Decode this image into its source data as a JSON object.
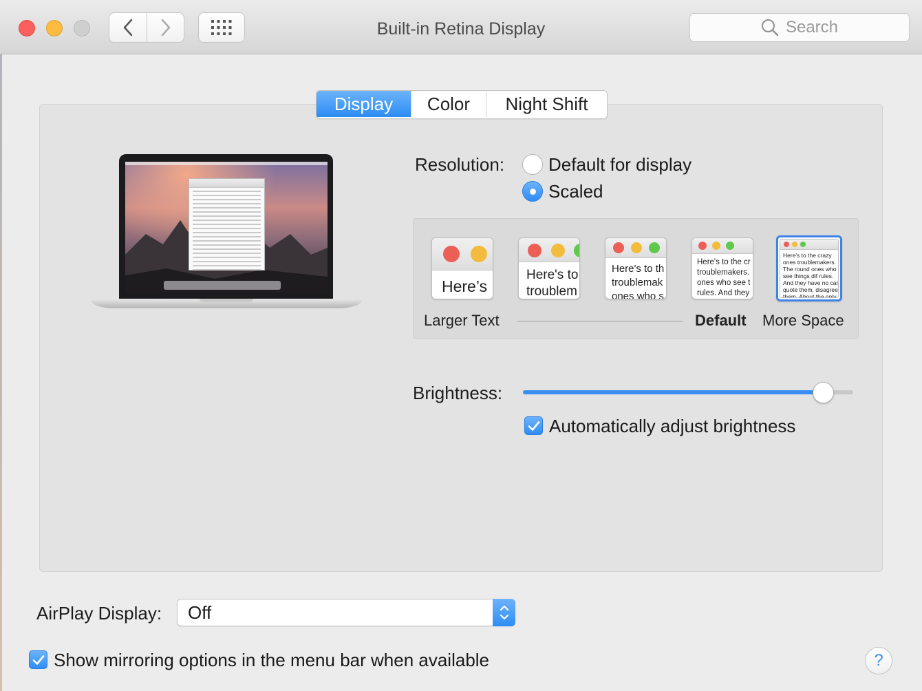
{
  "window": {
    "title": "Built-in Retina Display",
    "search_placeholder": "Search"
  },
  "tabs": [
    {
      "label": "Display",
      "selected": true
    },
    {
      "label": "Color",
      "selected": false
    },
    {
      "label": "Night Shift",
      "selected": false
    }
  ],
  "resolution": {
    "label": "Resolution:",
    "options": [
      {
        "label": "Default for display",
        "checked": false
      },
      {
        "label": "Scaled",
        "checked": true
      }
    ],
    "scaled_previews": [
      {
        "text": "Here’s"
      },
      {
        "text": "Here's to troublem"
      },
      {
        "text": "Here's to th troublemak ones who s"
      },
      {
        "text": "Here's to the cr troublemakers. ones who see t rules. And they"
      },
      {
        "text": "Here's to the crazy ones troublemakers. The round ones who see things dif rules. And they have no can quote them, disagree them. About the only th Because they change t"
      }
    ],
    "scale_labels": {
      "left": "Larger Text",
      "default": "Default",
      "right": "More Space"
    },
    "selected_index": 4
  },
  "brightness": {
    "label": "Brightness:",
    "level_percent": 91,
    "auto_label": "Automatically adjust brightness",
    "auto_checked": true
  },
  "airplay": {
    "label": "AirPlay Display:",
    "value": "Off"
  },
  "mirroring": {
    "label": "Show mirroring options in the menu bar when available",
    "checked": true
  },
  "help": {
    "label": "?"
  },
  "colors": {
    "accent": "#2f8df4",
    "close": "#fc605c",
    "minimize": "#fdbc40",
    "zoom_disabled": "#cfcfcf"
  },
  "icons": [
    "back-chevron-icon",
    "forward-chevron-icon",
    "grid-icon",
    "search-icon",
    "checkmark-icon",
    "updown-chevron-icon",
    "laptop-icon"
  ]
}
